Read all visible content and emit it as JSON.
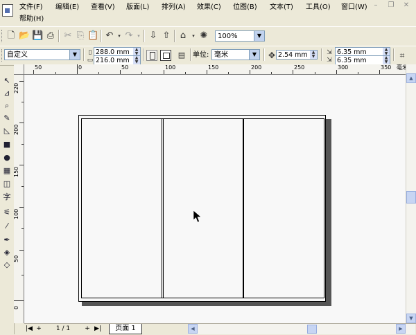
{
  "menu": {
    "items": [
      "文件(F)",
      "编辑(E)",
      "查看(V)",
      "版面(L)",
      "排列(A)",
      "效果(C)",
      "位图(B)",
      "文本(T)",
      "工具(O)",
      "窗口(W)",
      "帮助(H)"
    ]
  },
  "window_controls": [
    "minimize-icon",
    "restore-icon",
    "close-icon"
  ],
  "standard_toolbar": {
    "icons": [
      "new-document-icon",
      "open-icon",
      "save-icon",
      "print-icon",
      "cut-icon",
      "copy-icon",
      "paste-icon",
      "undo-icon",
      "redo-icon",
      "import-icon",
      "export-icon",
      "application-launcher-icon",
      "corel-online-icon"
    ],
    "zoom_level": "100%"
  },
  "property_bar": {
    "page_preset": "自定义",
    "page_width": "288.0 mm",
    "page_height": "216.0 mm",
    "units_label": "单位:",
    "units_value": "毫米",
    "nudge_distance": "2.54 mm",
    "duplicate_distance_x": "6.35 mm",
    "duplicate_distance_y": "6.35 mm"
  },
  "rulers": {
    "horizontal_labels": [
      "50",
      "0",
      "50",
      "100",
      "150",
      "200",
      "250",
      "300",
      "350",
      "毫米"
    ],
    "vertical_labels": [
      "220",
      "200",
      "150",
      "100",
      "50",
      "0"
    ]
  },
  "toolbox": {
    "tools": [
      "pick-tool-icon",
      "shape-tool-icon",
      "zoom-tool-icon",
      "freehand-tool-icon",
      "smart-fill-tool-icon",
      "rectangle-tool-icon",
      "ellipse-tool-icon",
      "polygon-tool-icon",
      "basic-shapes-tool-icon",
      "text-tool-icon",
      "interactive-blend-tool-icon",
      "eyedropper-tool-icon",
      "outline-tool-icon",
      "fill-tool-icon",
      "interactive-fill-tool-icon"
    ]
  },
  "document": {
    "panel_count": 3
  },
  "page_navigator": {
    "page_counter": "1 / 1",
    "page_tab": "页面 1"
  }
}
